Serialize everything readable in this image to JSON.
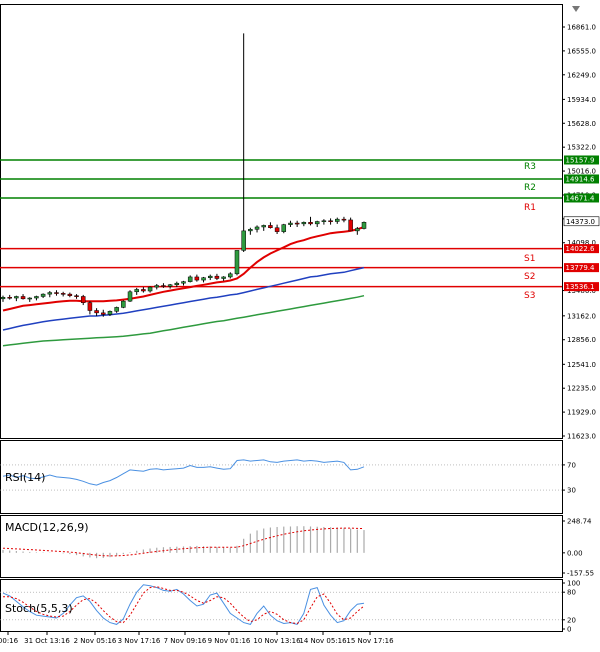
{
  "colors": {
    "resistance": "#008000",
    "support": "#e00000",
    "ma_fast": "#e00000",
    "ma_mid": "#2040c0",
    "ma_slow": "#2e9a3e",
    "bull_candle": "#2e9a3e",
    "bear_candle": "#e00000",
    "rsi_line": "#4a90e2",
    "macd_signal": "#e00000",
    "stoch_main": "#4a90e2",
    "stoch_signal": "#e00000"
  },
  "chart_data": [
    {
      "type": "candlestick",
      "title": "",
      "ylim": [
        11623.0,
        17000.0
      ],
      "y_ticks": [
        "16861.0",
        "16555.0",
        "16249.0",
        "15934.0",
        "15628.0",
        "15322.0",
        "15016.0",
        "14710.0",
        "14404.0",
        "14098.0",
        "13486.0",
        "13162.0",
        "12856.0",
        "12541.0",
        "12235.0",
        "11929.0",
        "11623.0"
      ],
      "x_labels": [
        "00:16",
        "31 Oct 13:16",
        "2 Nov 05:16",
        "3 Nov 17:16",
        "7 Nov 09:16",
        "9 Nov 01:16",
        "10 Nov 13:16",
        "14 Nov 05:16",
        "15 Nov 17:16"
      ],
      "last_price": "14373.0",
      "levels": [
        {
          "name": "R3",
          "value": 15157.9,
          "label": "15157.9",
          "kind": "resistance"
        },
        {
          "name": "",
          "value": 14914.6,
          "label": "14914.6",
          "kind": "resistance"
        },
        {
          "name": "R2",
          "value": 14671.4,
          "label": "14671.4",
          "kind": "resistance"
        },
        {
          "name": "R1",
          "value": 14022.6,
          "label": "14022.6",
          "kind": "support"
        },
        {
          "name": "S1",
          "value": 13779.4,
          "label": "13779.4",
          "kind": "support"
        },
        {
          "name": "S2",
          "value": 13536.1,
          "label": "13536.1",
          "kind": "support"
        },
        {
          "name": "S3",
          "value": null,
          "label": "",
          "kind": "support"
        }
      ],
      "candles": [
        [
          13380,
          13420,
          13340,
          13400
        ],
        [
          13400,
          13430,
          13370,
          13390
        ],
        [
          13390,
          13420,
          13350,
          13410
        ],
        [
          13410,
          13440,
          13370,
          13380
        ],
        [
          13380,
          13400,
          13340,
          13390
        ],
        [
          13390,
          13420,
          13360,
          13410
        ],
        [
          13410,
          13450,
          13390,
          13440
        ],
        [
          13440,
          13480,
          13400,
          13460
        ],
        [
          13460,
          13490,
          13420,
          13450
        ],
        [
          13450,
          13470,
          13410,
          13440
        ],
        [
          13440,
          13460,
          13400,
          13420
        ],
        [
          13420,
          13440,
          13380,
          13410
        ],
        [
          13410,
          13430,
          13300,
          13330
        ],
        [
          13330,
          13350,
          13180,
          13230
        ],
        [
          13230,
          13260,
          13160,
          13200
        ],
        [
          13200,
          13240,
          13150,
          13180
        ],
        [
          13180,
          13230,
          13160,
          13220
        ],
        [
          13220,
          13280,
          13200,
          13270
        ],
        [
          13270,
          13360,
          13260,
          13350
        ],
        [
          13350,
          13490,
          13340,
          13470
        ],
        [
          13470,
          13520,
          13430,
          13500
        ],
        [
          13500,
          13530,
          13460,
          13480
        ],
        [
          13480,
          13540,
          13460,
          13530
        ],
        [
          13530,
          13570,
          13500,
          13550
        ],
        [
          13550,
          13580,
          13520,
          13540
        ],
        [
          13540,
          13570,
          13510,
          13560
        ],
        [
          13560,
          13600,
          13530,
          13580
        ],
        [
          13580,
          13610,
          13550,
          13600
        ],
        [
          13600,
          13680,
          13590,
          13660
        ],
        [
          13660,
          13690,
          13600,
          13620
        ],
        [
          13620,
          13660,
          13590,
          13650
        ],
        [
          13650,
          13690,
          13620,
          13670
        ],
        [
          13670,
          13700,
          13620,
          13640
        ],
        [
          13640,
          13670,
          13610,
          13660
        ],
        [
          13660,
          13720,
          13640,
          13700
        ],
        [
          13700,
          14000,
          13680,
          14000
        ],
        [
          14000,
          16780,
          13980,
          14250
        ],
        [
          14250,
          14290,
          14200,
          14270
        ],
        [
          14270,
          14320,
          14230,
          14300
        ],
        [
          14300,
          14330,
          14250,
          14320
        ],
        [
          14320,
          14360,
          14280,
          14290
        ],
        [
          14290,
          14330,
          14210,
          14240
        ],
        [
          14240,
          14340,
          14220,
          14330
        ],
        [
          14330,
          14380,
          14300,
          14350
        ],
        [
          14350,
          14380,
          14300,
          14340
        ],
        [
          14340,
          14370,
          14310,
          14360
        ],
        [
          14360,
          14430,
          14320,
          14340
        ],
        [
          14340,
          14380,
          14300,
          14370
        ],
        [
          14370,
          14400,
          14330,
          14380
        ],
        [
          14380,
          14410,
          14330,
          14370
        ],
        [
          14370,
          14420,
          14340,
          14400
        ],
        [
          14400,
          14430,
          14360,
          14390
        ],
        [
          14390,
          14420,
          14320,
          14250
        ],
        [
          14250,
          14300,
          14200,
          14280
        ],
        [
          14280,
          14370,
          14270,
          14360
        ]
      ],
      "ma_fast": [
        13230,
        13250,
        13270,
        13290,
        13300,
        13310,
        13320,
        13330,
        13340,
        13350,
        13355,
        13355,
        13350,
        13350,
        13350,
        13350,
        13355,
        13360,
        13370,
        13380,
        13395,
        13410,
        13430,
        13450,
        13470,
        13485,
        13500,
        13515,
        13530,
        13545,
        13560,
        13575,
        13590,
        13600,
        13615,
        13640,
        13700,
        13780,
        13850,
        13910,
        13960,
        14000,
        14040,
        14080,
        14110,
        14130,
        14160,
        14180,
        14200,
        14220,
        14230,
        14240,
        14250,
        14270,
        14300
      ],
      "ma_mid": [
        12980,
        13000,
        13020,
        13040,
        13055,
        13070,
        13085,
        13100,
        13110,
        13120,
        13130,
        13140,
        13150,
        13160,
        13160,
        13170,
        13175,
        13185,
        13195,
        13210,
        13225,
        13240,
        13255,
        13270,
        13285,
        13300,
        13315,
        13330,
        13345,
        13360,
        13375,
        13390,
        13400,
        13415,
        13430,
        13440,
        13460,
        13480,
        13500,
        13520,
        13540,
        13560,
        13580,
        13600,
        13620,
        13640,
        13660,
        13670,
        13685,
        13700,
        13710,
        13720,
        13740,
        13760,
        13780
      ],
      "ma_slow": [
        12780,
        12790,
        12800,
        12810,
        12820,
        12830,
        12840,
        12845,
        12850,
        12855,
        12860,
        12865,
        12870,
        12875,
        12880,
        12885,
        12890,
        12895,
        12900,
        12910,
        12920,
        12930,
        12940,
        12955,
        12970,
        12985,
        13000,
        13015,
        13030,
        13045,
        13060,
        13075,
        13090,
        13100,
        13115,
        13130,
        13145,
        13160,
        13175,
        13190,
        13205,
        13220,
        13235,
        13250,
        13265,
        13280,
        13295,
        13310,
        13325,
        13340,
        13355,
        13370,
        13385,
        13400,
        13420
      ]
    },
    {
      "type": "line",
      "title": "RSI(14)",
      "ylim": [
        0,
        100
      ],
      "y_ticks": [
        "70",
        "30"
      ],
      "levels": [
        70,
        30
      ],
      "values": [
        52,
        54,
        50,
        53,
        49,
        48,
        51,
        54,
        51,
        50,
        49,
        47,
        44,
        40,
        38,
        42,
        45,
        50,
        56,
        62,
        61,
        60,
        63,
        64,
        62,
        63,
        64,
        65,
        69,
        66,
        66,
        67,
        65,
        63,
        64,
        77,
        78,
        76,
        77,
        78,
        75,
        74,
        76,
        77,
        78,
        76,
        77,
        76,
        74,
        75,
        76,
        74,
        62,
        63,
        67
      ]
    },
    {
      "type": "bar",
      "title": "MACD(12,26,9)",
      "ylim": [
        -157.55,
        248.74
      ],
      "y_ticks": [
        "248.74",
        "0.00",
        "-157.55"
      ],
      "values": [
        22,
        18,
        14,
        10,
        7,
        4,
        3,
        2,
        0,
        -4,
        -10,
        -18,
        -28,
        -36,
        -42,
        -40,
        -34,
        -24,
        -10,
        4,
        16,
        26,
        34,
        40,
        44,
        46,
        48,
        50,
        52,
        54,
        52,
        50,
        46,
        42,
        40,
        55,
        110,
        150,
        175,
        190,
        198,
        202,
        205,
        206,
        208,
        208,
        206,
        204,
        202,
        200,
        198,
        196,
        190,
        182,
        178
      ],
      "signal": [
        36,
        34,
        31,
        28,
        25,
        22,
        19,
        16,
        13,
        10,
        6,
        1,
        -5,
        -12,
        -18,
        -22,
        -24,
        -24,
        -21,
        -16,
        -10,
        -3,
        4,
        11,
        17,
        23,
        28,
        32,
        36,
        40,
        42,
        44,
        44,
        44,
        43,
        44,
        56,
        73,
        90,
        106,
        120,
        133,
        145,
        155,
        164,
        172,
        178,
        183,
        187,
        190,
        192,
        193,
        193,
        191,
        189
      ]
    },
    {
      "type": "line",
      "title": "Stoch(5,5,3)",
      "ylim": [
        0,
        100
      ],
      "y_ticks": [
        "100",
        "80",
        "20",
        "0"
      ],
      "levels": [
        80,
        20
      ],
      "values": [
        78,
        72,
        60,
        48,
        38,
        30,
        28,
        26,
        24,
        34,
        52,
        68,
        72,
        60,
        40,
        24,
        14,
        10,
        22,
        54,
        80,
        96,
        94,
        90,
        84,
        82,
        86,
        76,
        62,
        50,
        54,
        74,
        78,
        56,
        34,
        24,
        14,
        10,
        34,
        50,
        30,
        18,
        12,
        14,
        10,
        34,
        86,
        90,
        52,
        30,
        14,
        18,
        40,
        54,
        56
      ],
      "signal": [
        70,
        70,
        66,
        58,
        48,
        38,
        32,
        28,
        26,
        28,
        38,
        52,
        64,
        66,
        56,
        40,
        26,
        16,
        14,
        30,
        54,
        78,
        90,
        92,
        88,
        84,
        84,
        80,
        72,
        62,
        56,
        62,
        70,
        68,
        56,
        40,
        26,
        16,
        20,
        32,
        38,
        32,
        20,
        14,
        12,
        20,
        46,
        70,
        76,
        56,
        32,
        20,
        24,
        38,
        50
      ]
    }
  ]
}
